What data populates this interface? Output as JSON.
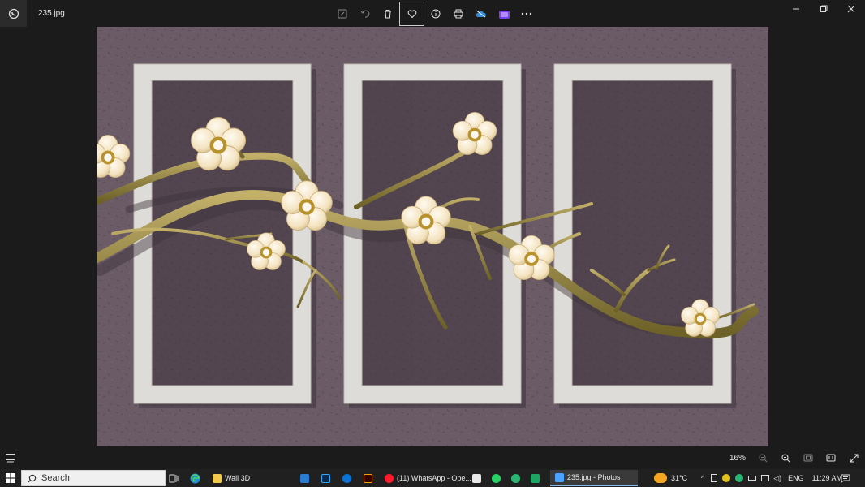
{
  "window": {
    "filename": "235.jpg",
    "toolbar": [
      "edit-icon",
      "rotate-icon",
      "delete-icon",
      "favorite-icon",
      "info-icon",
      "print-icon",
      "onedrive-icon",
      "clipchamp-icon",
      "more-icon"
    ]
  },
  "status": {
    "zoom": "16%"
  },
  "taskbar": {
    "search_label": "Search",
    "apps": [
      {
        "label": "Wall 3D",
        "icon": "folder-icon",
        "color": "#f2c94c"
      },
      {
        "label": "(11) WhatsApp - Ope...",
        "icon": "opera-icon",
        "color": "#ff1b2d"
      },
      {
        "label": "235.jpg - Photos",
        "icon": "photos-icon",
        "color": "#4aa3ff"
      }
    ],
    "temperature": "31°C",
    "language": "ENG",
    "time": "11:29 AM"
  }
}
